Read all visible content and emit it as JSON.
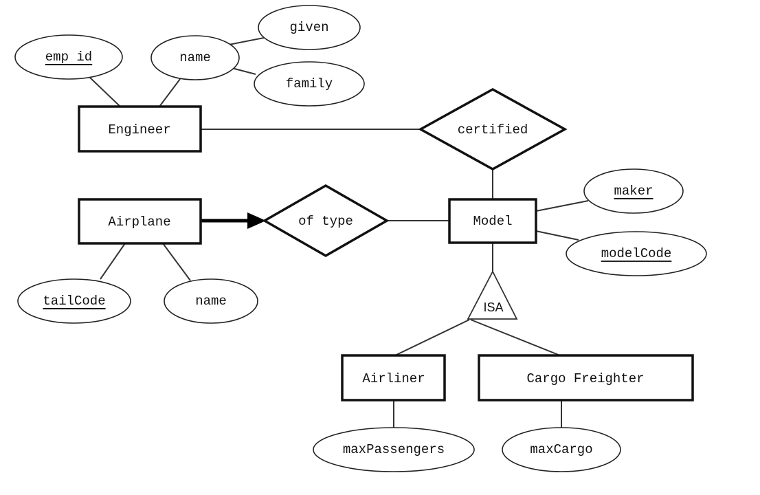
{
  "entities": {
    "engineer": "Engineer",
    "airplane": "Airplane",
    "model": "Model",
    "airliner": "Airliner",
    "cargo_freighter": "Cargo Freighter"
  },
  "relationships": {
    "certified": "certified",
    "of_type": "of type",
    "isa": "ISA"
  },
  "attributes": {
    "emp_id": "emp id",
    "name": "name",
    "given": "given",
    "family": "family",
    "maker": "maker",
    "model_code": "modelCode",
    "tail_code": "tailCode",
    "airplane_name": "name",
    "max_passengers": "maxPassengers",
    "max_cargo": "maxCargo"
  }
}
